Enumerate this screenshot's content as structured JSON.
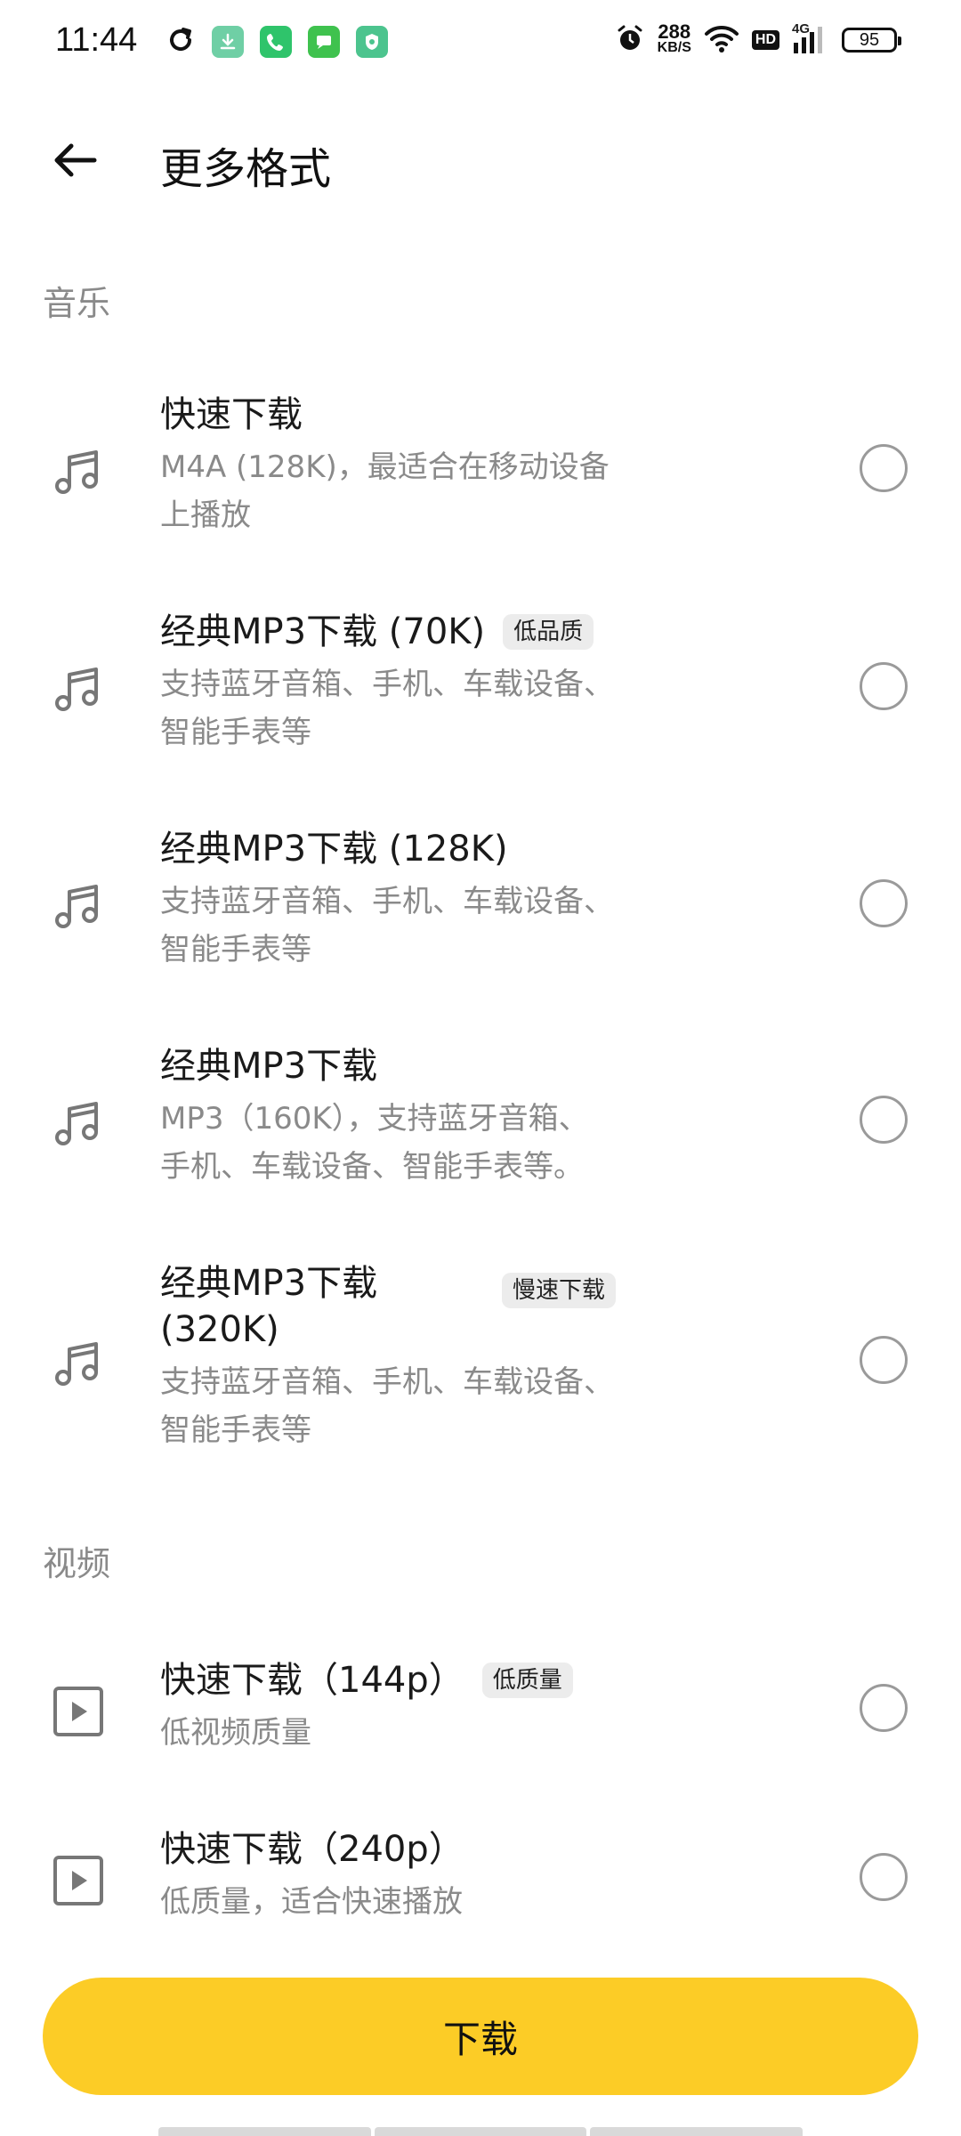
{
  "status_bar": {
    "time": "11:44",
    "net_speed_value": "288",
    "net_speed_unit": "KB/S",
    "hd_label": "HD",
    "network_label": "4G",
    "battery_level": "95",
    "badges": [
      "download-app-icon",
      "phone-app-icon",
      "messages-app-icon",
      "security-app-icon"
    ],
    "colors": {
      "download": "#5bc49a",
      "phone": "#2fc46b",
      "messages": "#3ac24a",
      "security": "#4cc48e"
    }
  },
  "header": {
    "title": "更多格式"
  },
  "sections": {
    "music_label": "音乐",
    "video_label": "视频"
  },
  "music_items": [
    {
      "title": "快速下载",
      "tag": "",
      "desc_line1": "M4A (128K)，最适合在移动设备",
      "desc_line2": "上播放"
    },
    {
      "title": "经典MP3下载 (70K)",
      "tag": "低品质",
      "desc_line1": "支持蓝牙音箱、手机、车载设备、",
      "desc_line2": "智能手表等"
    },
    {
      "title": "经典MP3下载 (128K)",
      "tag": "",
      "desc_line1": "支持蓝牙音箱、手机、车载设备、",
      "desc_line2": "智能手表等"
    },
    {
      "title": "经典MP3下载",
      "tag": "",
      "desc_line1": "MP3（160K），支持蓝牙音箱、",
      "desc_line2": "手机、车载设备、智能手表等。"
    },
    {
      "title_line1": "经典MP3下载",
      "title_line2": "(320K)",
      "tag": "慢速下载",
      "desc_line1": "支持蓝牙音箱、手机、车载设备、",
      "desc_line2": "智能手表等"
    }
  ],
  "video_items": [
    {
      "title": "快速下载（144p）",
      "tag": "低质量",
      "desc_line1": "低视频质量"
    },
    {
      "title": "快速下载（240p）",
      "tag": "",
      "desc_line1": "低质量，适合快速播放"
    }
  ],
  "download_button": {
    "label": "下载",
    "color": "#fccc26"
  }
}
